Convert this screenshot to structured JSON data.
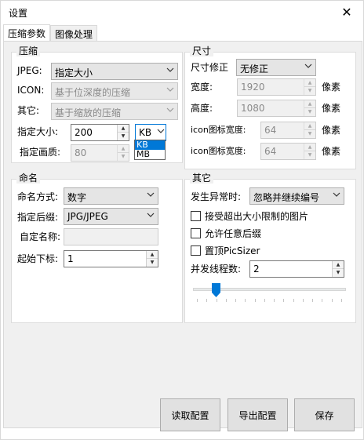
{
  "window": {
    "title": "设置",
    "close_symbol": "✕"
  },
  "tabs": [
    {
      "label": "压缩参数"
    },
    {
      "label": "图像处理"
    }
  ],
  "compression": {
    "group_label": "压缩",
    "jpeg_label": "JPEG:",
    "jpeg_value": "指定大小",
    "icon_label": "ICON:",
    "icon_value": "基于位深度的压缩",
    "other_label": "其它:",
    "other_value": "基于缩放的压缩",
    "size_label": "指定大小:",
    "size_value": "200",
    "unit_value": "KB",
    "unit_options": [
      "KB",
      "MB"
    ],
    "quality_label": "指定画质:",
    "quality_value": "80"
  },
  "dimensions": {
    "group_label": "尺寸",
    "fix_label": "尺寸修正",
    "fix_value": "无修正",
    "width_label": "宽度:",
    "width_value": "1920",
    "width_unit": "像素",
    "height_label": "高度:",
    "height_value": "1080",
    "height_unit": "像素",
    "icon_width_label": "icon图标宽度:",
    "icon_width_value": "64",
    "icon_width_unit": "像素",
    "icon_height_label": "icon图标宽度:",
    "icon_height_value": "64",
    "icon_height_unit": "像素"
  },
  "naming": {
    "group_label": "命名",
    "mode_label": "命名方式:",
    "mode_value": "数字",
    "suffix_label": "指定后缀:",
    "suffix_value": "JPG/JPEG",
    "custom_label": "自定名称:",
    "custom_value": "",
    "start_label": "起始下标:",
    "start_value": "1"
  },
  "other": {
    "group_label": "其它",
    "error_label": "发生异常时:",
    "error_value": "忽略并继续编号",
    "chk_oversize": "接受超出大小限制的图片",
    "chk_any_suffix": "允许任意后缀",
    "chk_topmost": "置顶PicSizer",
    "threads_label": "并发线程数:",
    "threads_value": "2",
    "threads_slider_fraction": 0.13
  },
  "buttons": {
    "read": "读取配置",
    "export": "导出配置",
    "save": "保存"
  },
  "icons": {
    "close": "close-icon",
    "dropdown": "chevron-down-icon",
    "spin_up": "spin-up-icon",
    "spin_down": "spin-down-icon",
    "slider_thumb": "slider-thumb-icon"
  },
  "colors": {
    "selection": "#0078d7",
    "thumb": "#0078d7"
  }
}
